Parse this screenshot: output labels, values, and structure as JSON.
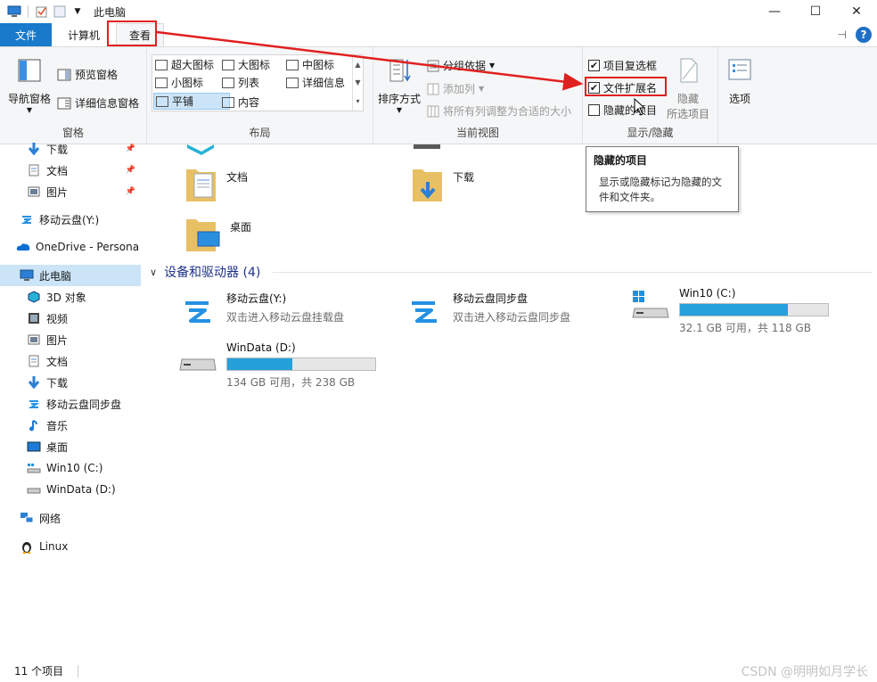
{
  "window": {
    "title": "此电脑",
    "minimize": "—",
    "maximize": "☐",
    "close": "✕"
  },
  "tabs": [
    {
      "label": "文件"
    },
    {
      "label": "计算机"
    },
    {
      "label": "查看"
    }
  ],
  "ribbon": {
    "panes": {
      "label": "窗格",
      "nav_pane": "导航窗格",
      "preview_pane": "预览窗格",
      "details_pane": "详细信息窗格"
    },
    "layout": {
      "label": "布局",
      "items": [
        "超大图标",
        "大图标",
        "中图标",
        "小图标",
        "列表",
        "详细信息",
        "平铺",
        "内容"
      ],
      "selected": "平铺"
    },
    "current_view": {
      "label": "当前视图",
      "sort_by": "排序方式",
      "group_by": "分组依据",
      "add_column": "添加列",
      "fit_columns": "将所有列调整为合适的大小"
    },
    "show_hide": {
      "label": "显示/隐藏",
      "item_checkboxes": {
        "label": "项目复选框",
        "checked": true
      },
      "file_extensions": {
        "label": "文件扩展名",
        "checked": true
      },
      "hidden_items": {
        "label": "隐藏的项目",
        "checked": false
      },
      "hide_selected_line1": "隐藏",
      "hide_selected_line2": "所选项目"
    },
    "options": "选项"
  },
  "tooltip": {
    "title": "隐藏的项目",
    "body": "显示或隐藏标记为隐藏的文件和文件夹。"
  },
  "sidebar": {
    "items": [
      {
        "label": "下载",
        "icon": "download-icon",
        "pinned": true
      },
      {
        "label": "文档",
        "icon": "document-icon",
        "pinned": true
      },
      {
        "label": "图片",
        "icon": "picture-icon",
        "pinned": true
      },
      {
        "label": "移动云盘(Y:)",
        "icon": "cloud-drive-icon",
        "pinned": false
      },
      {
        "label": "OneDrive - Persona",
        "icon": "onedrive-icon",
        "pinned": false
      },
      {
        "label": "此电脑",
        "icon": "this-pc-icon",
        "pinned": false,
        "selected": true
      },
      {
        "label": "3D 对象",
        "icon": "3d-objects-icon",
        "pinned": false
      },
      {
        "label": "视频",
        "icon": "video-icon",
        "pinned": false
      },
      {
        "label": "图片",
        "icon": "picture-icon",
        "pinned": false
      },
      {
        "label": "文档",
        "icon": "document-icon",
        "pinned": false
      },
      {
        "label": "下载",
        "icon": "download-icon",
        "pinned": false
      },
      {
        "label": "移动云盘同步盘",
        "icon": "cloud-sync-icon",
        "pinned": false
      },
      {
        "label": "音乐",
        "icon": "music-icon",
        "pinned": false
      },
      {
        "label": "桌面",
        "icon": "desktop-icon",
        "pinned": false
      },
      {
        "label": "Win10 (C:)",
        "icon": "system-drive-icon",
        "pinned": false
      },
      {
        "label": "WinData (D:)",
        "icon": "drive-icon",
        "pinned": false
      },
      {
        "label": "网络",
        "icon": "network-icon",
        "pinned": false
      },
      {
        "label": "Linux",
        "icon": "linux-icon",
        "pinned": false
      }
    ]
  },
  "folders": [
    {
      "label": "文档"
    },
    {
      "label": "下载"
    },
    {
      "label": "桌面"
    }
  ],
  "devices": {
    "header": "设备和驱动器 (4)",
    "items": [
      {
        "name": "移动云盘(Y:)",
        "sub": "双击进入移动云盘挂载盘"
      },
      {
        "name": "移动云盘同步盘",
        "sub": "双击进入移动云盘同步盘"
      },
      {
        "name": "Win10 (C:)",
        "sub": "32.1 GB 可用，共 118 GB",
        "used_fraction": 0.728
      },
      {
        "name": "WinData (D:)",
        "sub": "134 GB 可用，共 238 GB",
        "used_fraction": 0.437
      }
    ]
  },
  "status": {
    "count": "11 个项目"
  },
  "watermark": "CSDN @明明如月学长",
  "colors": {
    "accent": "#1979ca",
    "annotation": "#e0201f",
    "drive_fill": "#26a0da",
    "selection": "#cce4f7"
  }
}
